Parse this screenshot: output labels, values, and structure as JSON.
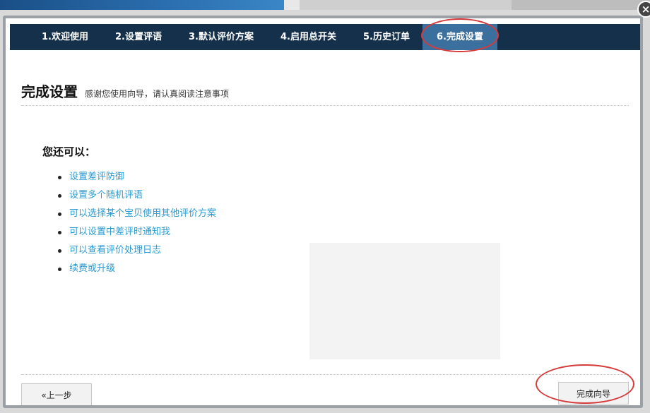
{
  "tabs": [
    {
      "label": "1.欢迎使用"
    },
    {
      "label": "2.设置评语"
    },
    {
      "label": "3.默认评价方案"
    },
    {
      "label": "4.启用总开关"
    },
    {
      "label": "5.历史订单"
    },
    {
      "label": "6.完成设置"
    }
  ],
  "active_tab": 5,
  "header": {
    "title": "完成设置",
    "subtitle": "感谢您使用向导，请认真阅读注意事项"
  },
  "content": {
    "heading": "您还可以：",
    "options": [
      "设置差评防御",
      "设置多个随机评语",
      "可以选择某个宝贝使用其他评价方案",
      "可以设置中差评时通知我",
      "可以查看评价处理日志",
      "续费或升级"
    ]
  },
  "buttons": {
    "prev": "«上一步",
    "finish": "完成向导"
  },
  "icons": {
    "close": "close-icon"
  },
  "colors": {
    "tabbar": "#15304a",
    "active_tab": "#3b6f9e",
    "link": "#2a9bd3",
    "highlight": "#d63a3a"
  }
}
